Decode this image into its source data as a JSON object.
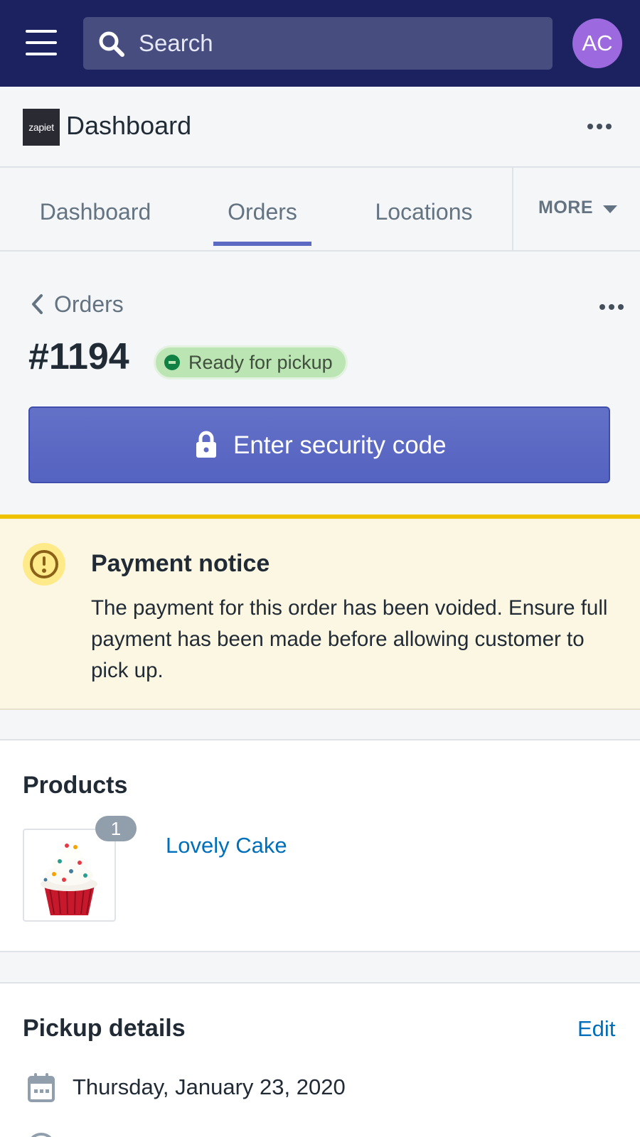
{
  "topbar": {
    "search_placeholder": "Search",
    "avatar_initials": "AC"
  },
  "appbar": {
    "logo_text": "zapiet",
    "title": "Dashboard"
  },
  "tabs": {
    "items": [
      {
        "label": "Dashboard",
        "active": false
      },
      {
        "label": "Orders",
        "active": true
      },
      {
        "label": "Locations",
        "active": false
      }
    ],
    "more_label": "MORE"
  },
  "breadcrumb": {
    "label": "Orders"
  },
  "order": {
    "title": "#1194",
    "status": "Ready for pickup"
  },
  "primary_action": {
    "label": "Enter security code"
  },
  "banner": {
    "title": "Payment notice",
    "body": "The payment for this order has been voided. Ensure full payment has been made before allowing customer to pick up."
  },
  "products": {
    "title": "Products",
    "items": [
      {
        "name": "Lovely Cake",
        "quantity": "1"
      }
    ]
  },
  "pickup": {
    "title": "Pickup details",
    "edit_label": "Edit",
    "date": "Thursday, January 23, 2020"
  },
  "colors": {
    "topbar": "#1c2260",
    "primary": "#5c6ac4",
    "status_badge": "#bbe5b3",
    "warning": "#eec200",
    "link": "#006fbb"
  },
  "icons": [
    "menu-icon",
    "search-icon",
    "more-icon",
    "caret-down-icon",
    "chevron-left-icon",
    "lock-icon",
    "alert-icon",
    "calendar-icon"
  ]
}
